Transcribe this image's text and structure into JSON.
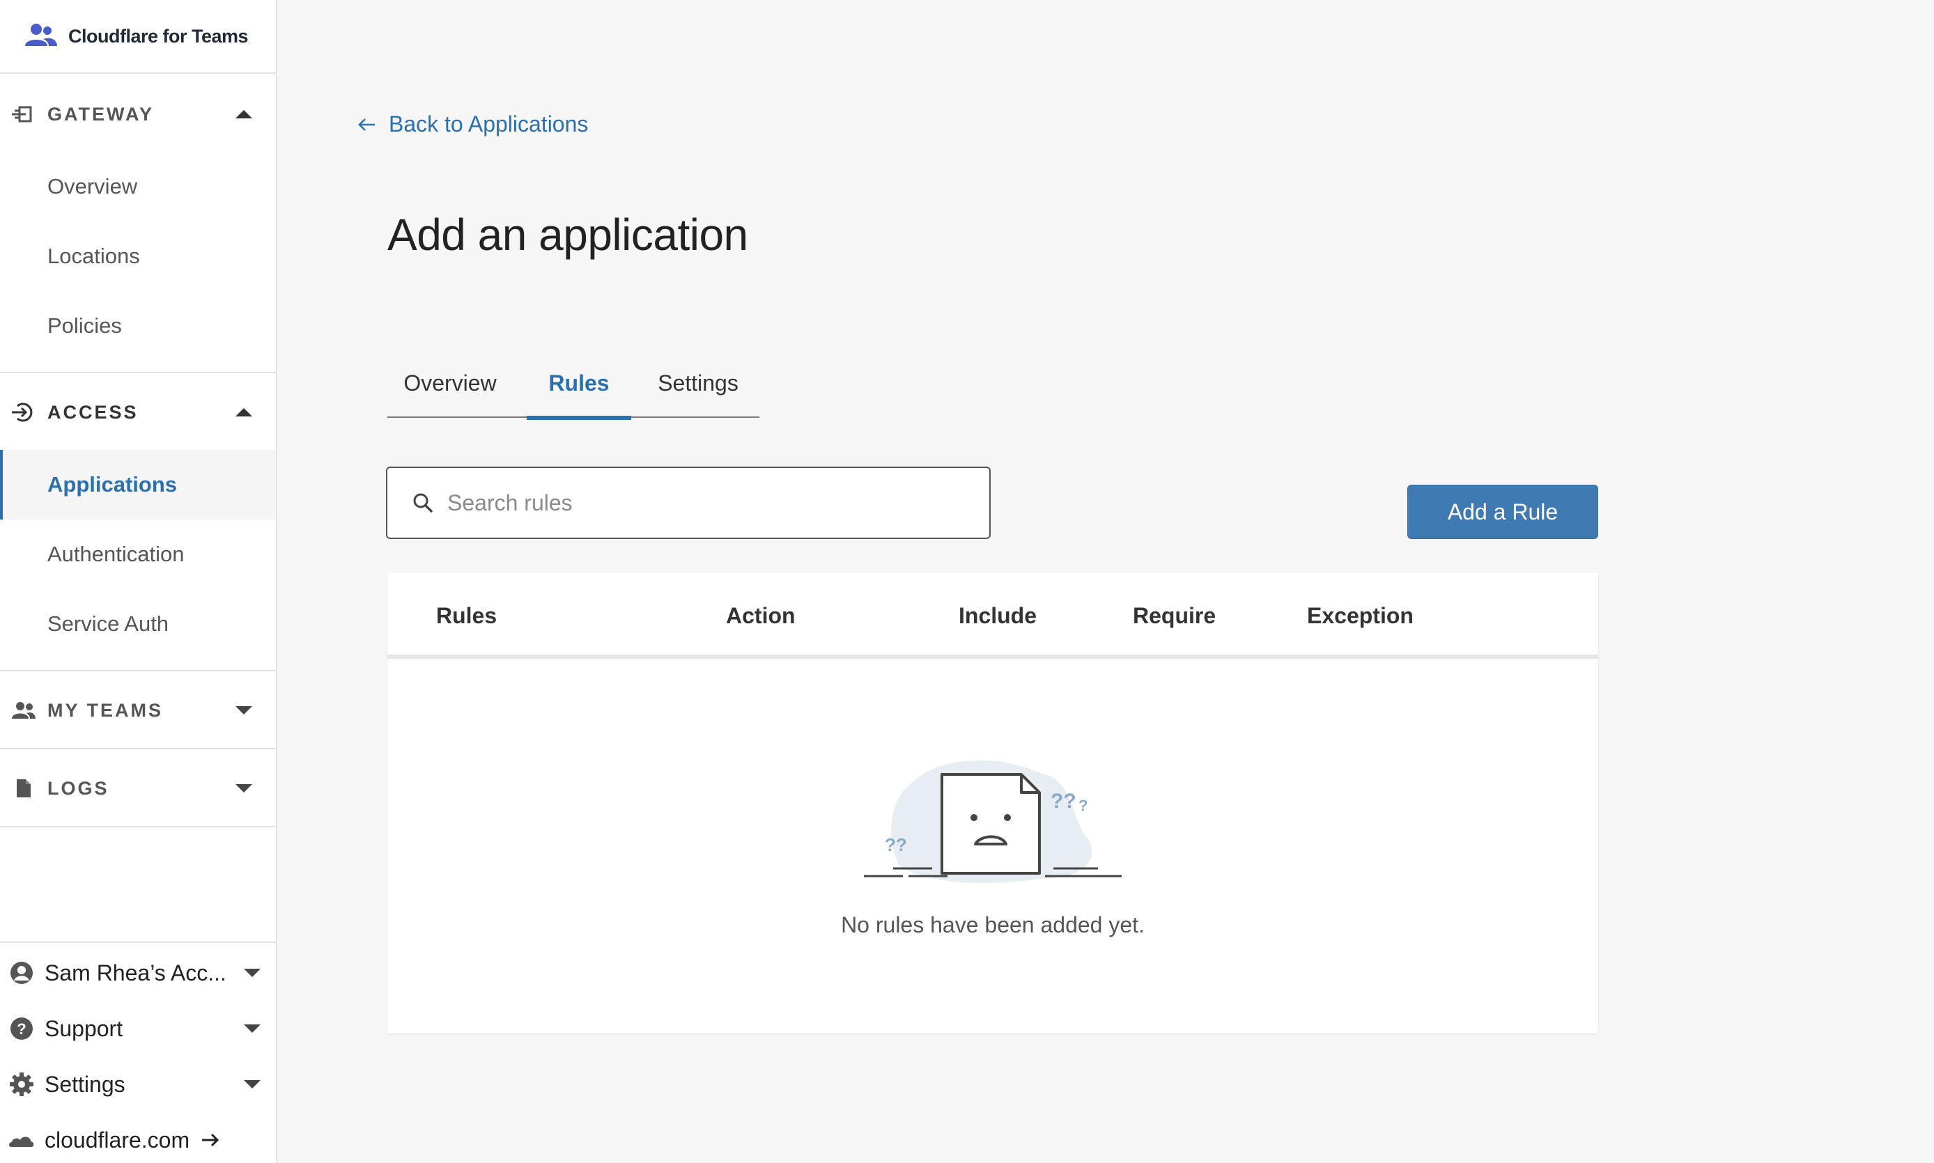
{
  "brand": {
    "name": "Cloudflare for Teams"
  },
  "sidebar": {
    "gateway": {
      "label": "GATEWAY",
      "items": [
        {
          "label": "Overview"
        },
        {
          "label": "Locations"
        },
        {
          "label": "Policies"
        }
      ]
    },
    "access": {
      "label": "ACCESS",
      "items": [
        {
          "label": "Applications",
          "active": true
        },
        {
          "label": "Authentication"
        },
        {
          "label": "Service Auth"
        }
      ]
    },
    "my_teams": {
      "label": "MY TEAMS"
    },
    "logs": {
      "label": "LOGS"
    },
    "footer": {
      "account": "Sam Rhea’s Acc...",
      "support": "Support",
      "settings": "Settings",
      "site": "cloudflare.com"
    }
  },
  "main": {
    "back_link": "Back to Applications",
    "title": "Add an application",
    "tabs": [
      {
        "label": "Overview"
      },
      {
        "label": "Rules",
        "active": true
      },
      {
        "label": "Settings"
      }
    ],
    "search": {
      "placeholder": "Search rules",
      "value": ""
    },
    "add_button": "Add a Rule",
    "table": {
      "columns": [
        "Rules",
        "Action",
        "Include",
        "Require",
        "Exception"
      ],
      "rows": [],
      "empty_message": "No rules have been added yet."
    }
  },
  "colors": {
    "accent": "#2a70ae",
    "button": "#3f7ab3",
    "background": "#f6f6f6",
    "brand_icon": "#4a5cc7"
  },
  "icons": {
    "brand": "teams-logo-icon",
    "gateway": "gateway-icon",
    "access": "access-icon",
    "my_teams": "people-icon",
    "logs": "document-icon",
    "account": "user-circle-icon",
    "support": "help-circle-icon",
    "settings": "gear-icon",
    "site": "cloud-icon"
  }
}
